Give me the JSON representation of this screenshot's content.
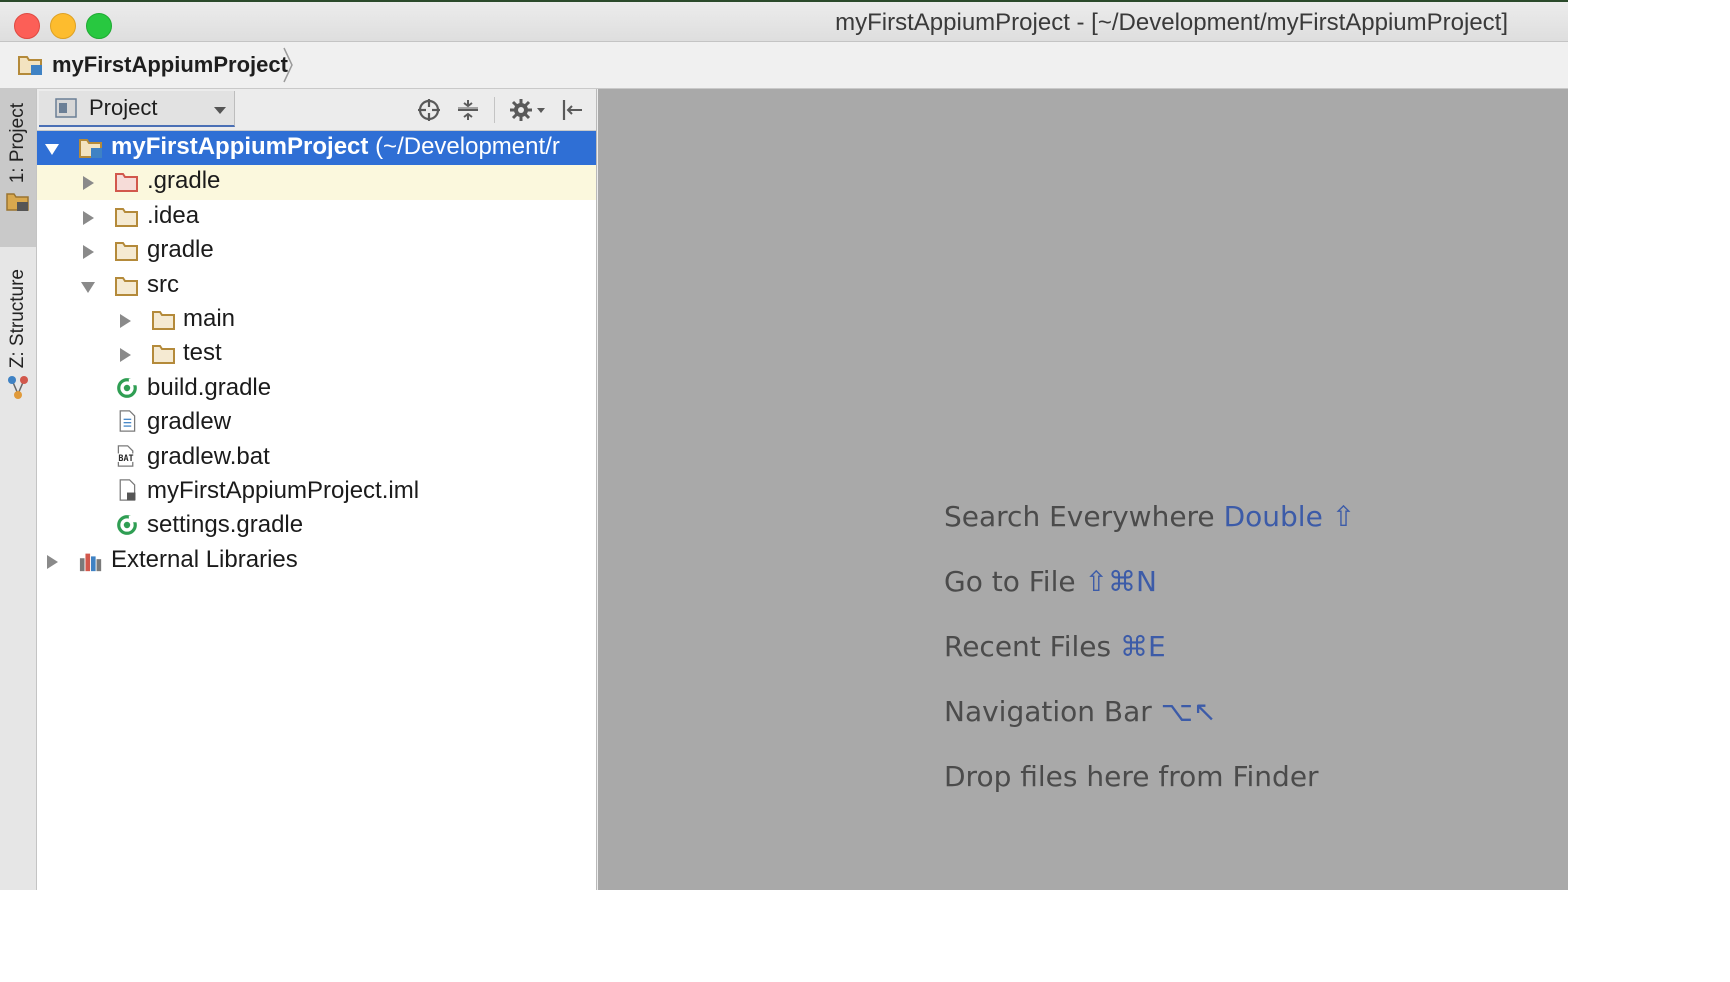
{
  "window": {
    "title": "myFirstAppiumProject - [~/Development/myFirstAppiumProject]"
  },
  "navbar": {
    "crumb": "myFirstAppiumProject"
  },
  "tool_strip": {
    "tabs": [
      {
        "label": "1: Project",
        "icon": "project-folder-icon",
        "active": true
      },
      {
        "label": "Z: Structure",
        "icon": "structure-icon",
        "active": false
      }
    ]
  },
  "project_panel": {
    "view_selector": "Project",
    "header_buttons": [
      "scroll-from-source-icon",
      "collapse-all-icon",
      "settings-icon",
      "hide-panel-icon"
    ],
    "tree": {
      "root": {
        "name": "myFirstAppiumProject",
        "path": "(~/Development/r"
      },
      "items": [
        {
          "label": ".gradle",
          "type": "folder-excluded",
          "expanded": false
        },
        {
          "label": ".idea",
          "type": "folder",
          "expanded": false
        },
        {
          "label": "gradle",
          "type": "folder",
          "expanded": false
        },
        {
          "label": "src",
          "type": "folder",
          "expanded": true
        },
        {
          "label": "main",
          "type": "folder",
          "expanded": false
        },
        {
          "label": "test",
          "type": "folder",
          "expanded": false
        },
        {
          "label": "build.gradle",
          "type": "gradle-file"
        },
        {
          "label": "gradlew",
          "type": "text-file"
        },
        {
          "label": "gradlew.bat",
          "type": "bat-file"
        },
        {
          "label": "myFirstAppiumProject.iml",
          "type": "iml-file"
        },
        {
          "label": "settings.gradle",
          "type": "gradle-file"
        },
        {
          "label": "External Libraries",
          "type": "libraries",
          "expanded": false
        }
      ]
    }
  },
  "editor": {
    "hints": [
      {
        "text": "Search Everywhere",
        "shortcut": "Double ⇧"
      },
      {
        "text": "Go to File",
        "shortcut": "⇧⌘N"
      },
      {
        "text": "Recent Files",
        "shortcut": "⌘E"
      },
      {
        "text": "Navigation Bar",
        "shortcut": "⌥↖"
      },
      {
        "text": "Drop files here from Finder",
        "shortcut": ""
      }
    ]
  },
  "colors": {
    "selection": "#2f6fd5",
    "editor_bg": "#a9a9a9",
    "shortcut": "#3c5ba8",
    "folder": "#b48a3a",
    "excluded_folder": "#d2584c"
  }
}
